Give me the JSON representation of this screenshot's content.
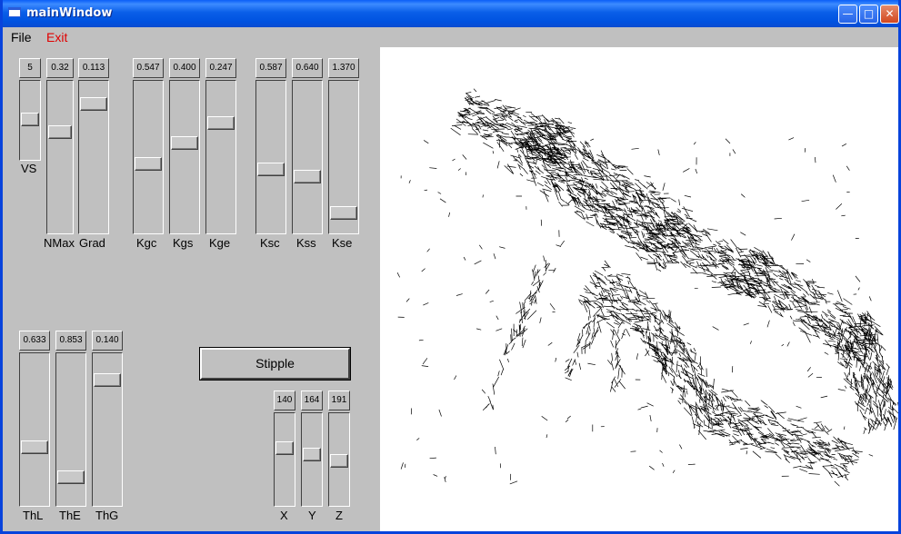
{
  "window": {
    "title": "mainWindow"
  },
  "menu": {
    "file": "File",
    "exit": "Exit"
  },
  "sliders": [
    {
      "id": "vs",
      "label": "VS",
      "value": "5",
      "position": 0.48
    },
    {
      "id": "nmax",
      "label": "NMax",
      "value": "0.32",
      "position": 0.32
    },
    {
      "id": "grad",
      "label": "Grad",
      "value": "0.113",
      "position": 0.11
    },
    {
      "id": "kgc",
      "label": "Kgc",
      "value": "0.547",
      "position": 0.55
    },
    {
      "id": "kgs",
      "label": "Kgs",
      "value": "0.400",
      "position": 0.4
    },
    {
      "id": "kge",
      "label": "Kge",
      "value": "0.247",
      "position": 0.25
    },
    {
      "id": "ksc",
      "label": "Ksc",
      "value": "0.587",
      "position": 0.59
    },
    {
      "id": "kss",
      "label": "Kss",
      "value": "0.640",
      "position": 0.64
    },
    {
      "id": "kse",
      "label": "Kse",
      "value": "1.370",
      "position": 0.91
    },
    {
      "id": "thl",
      "label": "ThL",
      "value": "0.633",
      "position": 0.63
    },
    {
      "id": "the",
      "label": "ThE",
      "value": "0.853",
      "position": 0.85
    },
    {
      "id": "thg",
      "label": "ThG",
      "value": "0.140",
      "position": 0.14
    },
    {
      "id": "x",
      "label": "X",
      "value": "140",
      "position": 0.35
    },
    {
      "id": "y",
      "label": "Y",
      "value": "164",
      "position": 0.43
    },
    {
      "id": "z",
      "label": "Z",
      "value": "191",
      "position": 0.52
    }
  ],
  "stipple_button": "Stipple"
}
